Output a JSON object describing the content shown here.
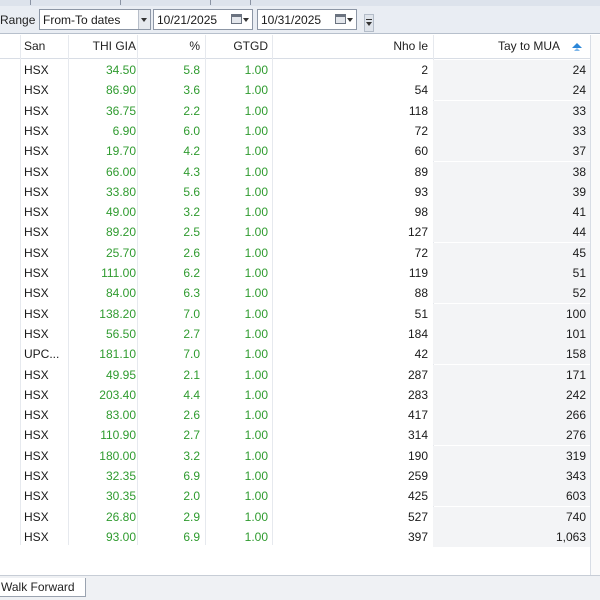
{
  "toolbar": {
    "range_label": "Range",
    "range_mode": "From-To dates",
    "from_date": "10/21/2025",
    "to_date": "10/31/2025"
  },
  "table": {
    "columns": [
      "San",
      "THI GIA",
      "%",
      "GTGD",
      "Nho le",
      "Tay to MUA"
    ],
    "rows": [
      [
        "HSX",
        "34.50",
        "5.8",
        "1.00",
        "2",
        "24"
      ],
      [
        "HSX",
        "86.90",
        "3.6",
        "1.00",
        "54",
        "24"
      ],
      [
        "HSX",
        "36.75",
        "2.2",
        "1.00",
        "118",
        "33"
      ],
      [
        "HSX",
        "6.90",
        "6.0",
        "1.00",
        "72",
        "33"
      ],
      [
        "HSX",
        "19.70",
        "4.2",
        "1.00",
        "60",
        "37"
      ],
      [
        "HSX",
        "66.00",
        "4.3",
        "1.00",
        "89",
        "38"
      ],
      [
        "HSX",
        "33.80",
        "5.6",
        "1.00",
        "93",
        "39"
      ],
      [
        "HSX",
        "49.00",
        "3.2",
        "1.00",
        "98",
        "41"
      ],
      [
        "HSX",
        "89.20",
        "2.5",
        "1.00",
        "127",
        "44"
      ],
      [
        "HSX",
        "25.70",
        "2.6",
        "1.00",
        "72",
        "45"
      ],
      [
        "HSX",
        "111.00",
        "6.2",
        "1.00",
        "119",
        "51"
      ],
      [
        "HSX",
        "84.00",
        "6.3",
        "1.00",
        "88",
        "52"
      ],
      [
        "HSX",
        "138.20",
        "7.0",
        "1.00",
        "51",
        "100"
      ],
      [
        "HSX",
        "56.50",
        "2.7",
        "1.00",
        "184",
        "101"
      ],
      [
        "UPC...",
        "181.10",
        "7.0",
        "1.00",
        "42",
        "158"
      ],
      [
        "HSX",
        "49.95",
        "2.1",
        "1.00",
        "287",
        "171"
      ],
      [
        "HSX",
        "203.40",
        "4.4",
        "1.00",
        "283",
        "242"
      ],
      [
        "HSX",
        "83.00",
        "2.6",
        "1.00",
        "417",
        "266"
      ],
      [
        "HSX",
        "110.90",
        "2.7",
        "1.00",
        "314",
        "276"
      ],
      [
        "HSX",
        "180.00",
        "3.2",
        "1.00",
        "190",
        "319"
      ],
      [
        "HSX",
        "32.35",
        "6.9",
        "1.00",
        "259",
        "343"
      ],
      [
        "HSX",
        "30.35",
        "2.0",
        "1.00",
        "425",
        "603"
      ],
      [
        "HSX",
        "26.80",
        "2.9",
        "1.00",
        "527",
        "740"
      ],
      [
        "HSX",
        "93.00",
        "6.9",
        "1.00",
        "397",
        "1,063"
      ]
    ],
    "sort_icon": "sort-ascending-icon"
  },
  "footer": {
    "sheet_tab": "Walk Forward"
  },
  "colors": {
    "positive_green": "#2f9b2f",
    "toolbar_bg": "#e9edf3"
  }
}
